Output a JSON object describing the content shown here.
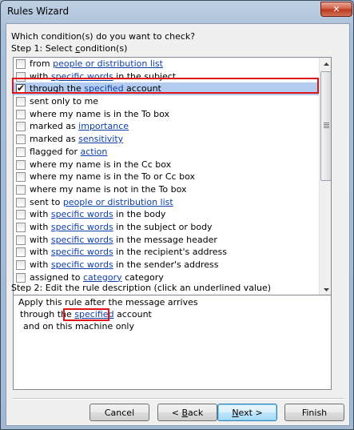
{
  "window": {
    "title": "Rules Wizard",
    "close_glyph": "✕"
  },
  "question": "Which condition(s) do you want to check?",
  "step1": {
    "label_pre": "Step 1: Select ",
    "label_u": "c",
    "label_post": "ondition(s)"
  },
  "conditions": [
    {
      "checked": false,
      "pre": "from ",
      "link": "people or distribution list",
      "post": ""
    },
    {
      "checked": false,
      "pre": "with ",
      "link": "specific words",
      "post": " in the subject"
    },
    {
      "checked": true,
      "pre": "through the ",
      "link": "specified",
      "post": " account"
    },
    {
      "checked": false,
      "pre": "sent only to me",
      "link": "",
      "post": ""
    },
    {
      "checked": false,
      "pre": "where my name is in the To box",
      "link": "",
      "post": ""
    },
    {
      "checked": false,
      "pre": "marked as ",
      "link": "importance",
      "post": ""
    },
    {
      "checked": false,
      "pre": "marked as ",
      "link": "sensitivity",
      "post": ""
    },
    {
      "checked": false,
      "pre": "flagged for ",
      "link": "action",
      "post": ""
    },
    {
      "checked": false,
      "pre": "where my name is in the Cc box",
      "link": "",
      "post": ""
    },
    {
      "checked": false,
      "pre": "where my name is in the To or Cc box",
      "link": "",
      "post": ""
    },
    {
      "checked": false,
      "pre": "where my name is not in the To box",
      "link": "",
      "post": ""
    },
    {
      "checked": false,
      "pre": "sent to ",
      "link": "people or distribution list",
      "post": ""
    },
    {
      "checked": false,
      "pre": "with ",
      "link": "specific words",
      "post": " in the body"
    },
    {
      "checked": false,
      "pre": "with ",
      "link": "specific words",
      "post": " in the subject or body"
    },
    {
      "checked": false,
      "pre": "with ",
      "link": "specific words",
      "post": " in the message header"
    },
    {
      "checked": false,
      "pre": "with ",
      "link": "specific words",
      "post": " in the recipient's address"
    },
    {
      "checked": false,
      "pre": "with ",
      "link": "specific words",
      "post": " in the sender's address"
    },
    {
      "checked": false,
      "pre": "assigned to ",
      "link": "category",
      "post": " category"
    }
  ],
  "step2": {
    "label": "Step 2: Edit the rule description (click an underlined value)",
    "line1": "Apply this rule after the message arrives",
    "line2_pre": "through the ",
    "line2_link": "specified",
    "line2_post": " account",
    "line3": "and on this machine only"
  },
  "buttons": {
    "cancel": "Cancel",
    "back_pre": "< ",
    "back_u": "B",
    "back_post": "ack",
    "next_u": "N",
    "next_post": "ext >",
    "finish": "Finish"
  },
  "highlight_color": "#e0151c",
  "selection_color": "#b2cdf0",
  "link_color": "#0e3ea8"
}
